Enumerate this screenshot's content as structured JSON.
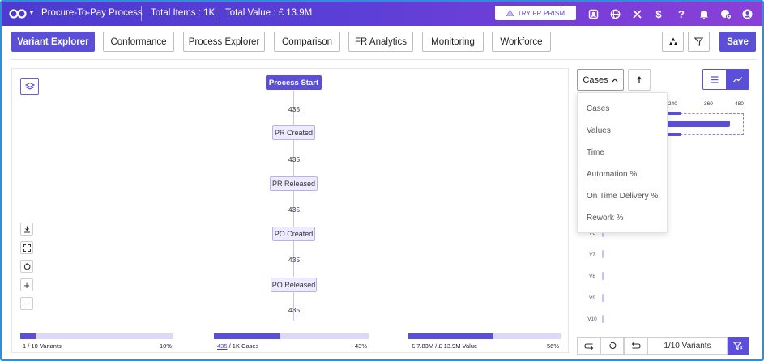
{
  "header": {
    "app_title": "Procure-To-Pay Process",
    "total_items": "Total Items : 1K",
    "total_value": "Total Value : £ 13.9M",
    "prism_button": "TRY FR PRISM"
  },
  "tabs": [
    {
      "label": "Variant Explorer",
      "active": true
    },
    {
      "label": "Conformance"
    },
    {
      "label": "Process Explorer"
    },
    {
      "label": "Comparison"
    },
    {
      "label": "FR Analytics"
    },
    {
      "label": "Monitoring"
    },
    {
      "label": "Workforce"
    }
  ],
  "toolbar": {
    "save_label": "Save"
  },
  "process_map": {
    "nodes": [
      "Process Start",
      "PR Created",
      "PR Released",
      "PO Created",
      "PO Released"
    ],
    "edges": [
      "435",
      "435",
      "435",
      "435",
      "435"
    ]
  },
  "summary": {
    "variants_current": "1",
    "variants_rest": " / 10 Variants",
    "variants_pct": "10%",
    "variants_fraction": 0.1,
    "cases_current": "435",
    "cases_rest": " / 1K Cases",
    "cases_pct": "43%",
    "cases_fraction": 0.43,
    "value_current": "£ 7.83M",
    "value_rest": " / £ 13.9M Value",
    "value_pct": "56%",
    "value_fraction": 0.56
  },
  "variants_panel": {
    "metric_selected": "Cases",
    "axis_ticks": [
      "240",
      "360",
      "480"
    ],
    "variant_labels": [
      "V6",
      "V7",
      "V8",
      "V9",
      "V10"
    ],
    "pagination": "1/10 Variants"
  },
  "metric_menu": {
    "items": [
      "Cases",
      "Values",
      "Time",
      "Automation %",
      "On Time Delivery %",
      "Rework %"
    ]
  },
  "colors": {
    "accent": "#5b4fd8",
    "header_start": "#4c3bcf",
    "header_end": "#8a40d6",
    "node_fill": "#eeeaff"
  },
  "icons": [
    "logo-icon",
    "profile-icon",
    "globe-icon",
    "tools-icon",
    "dollar-icon",
    "help-icon",
    "bell-icon",
    "settings-icon",
    "user-icon",
    "layers-icon",
    "download-icon",
    "fit-screen-icon",
    "reset-icon",
    "zoom-in-icon",
    "zoom-out-icon",
    "hierarchy-icon",
    "filter-icon",
    "sort-icon",
    "list-icon",
    "trend-icon",
    "prev-loop-icon",
    "undo-icon",
    "next-loop-icon"
  ]
}
